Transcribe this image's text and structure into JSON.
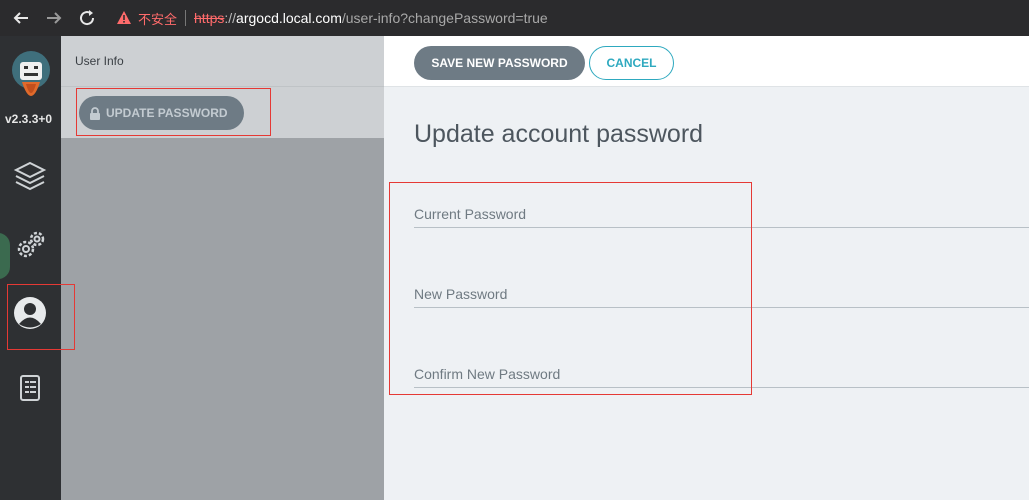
{
  "browser": {
    "insecure_label": "不安全",
    "url_protocol": "https",
    "url_sep": "://",
    "url_domain": "argocd.local.com",
    "url_path": "/user-info?changePassword=true"
  },
  "sidebar": {
    "version": "v2.3.3+0",
    "items": [
      {
        "icon": "layers-icon"
      },
      {
        "icon": "gears-icon"
      },
      {
        "icon": "user-icon"
      },
      {
        "icon": "docs-icon"
      }
    ]
  },
  "user_info_panel": {
    "title": "User Info",
    "update_password_label": "UPDATE PASSWORD"
  },
  "toolbar": {
    "save_label": "SAVE NEW PASSWORD",
    "cancel_label": "CANCEL"
  },
  "form": {
    "title": "Update account password",
    "fields": [
      {
        "label": "Current Password",
        "value": ""
      },
      {
        "label": "New Password",
        "value": ""
      },
      {
        "label": "Confirm New Password",
        "value": ""
      }
    ]
  },
  "colors": {
    "sidebar_bg": "#2e3033",
    "primary_button": "#6e7b85",
    "accent_teal": "#2ea9bf",
    "annotation_red": "#e53935",
    "insecure_red": "#ff6b6b"
  }
}
